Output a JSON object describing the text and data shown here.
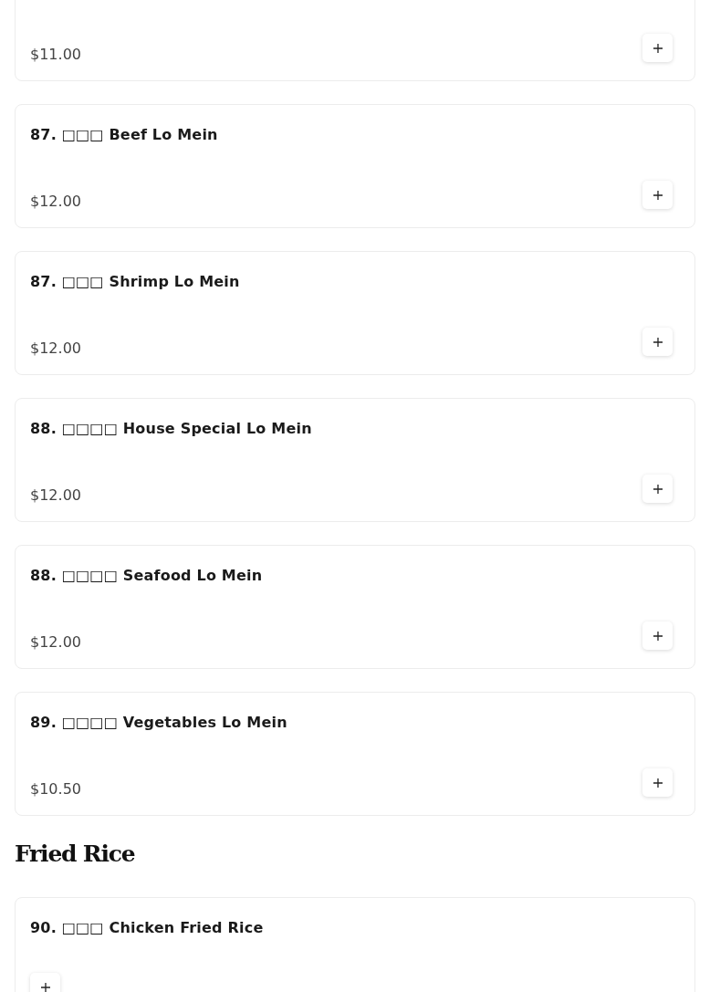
{
  "sections": [
    {
      "items": [
        {
          "price": "$11.00"
        },
        {
          "title": "87. □□□ Beef Lo Mein",
          "price": "$12.00"
        },
        {
          "title": "87. □□□ Shrimp Lo Mein",
          "price": "$12.00"
        },
        {
          "title": "88. □□□□ House Special Lo Mein",
          "price": "$12.00"
        },
        {
          "title": "88. □□□□ Seafood Lo Mein",
          "price": "$12.00"
        },
        {
          "title": "89. □□□□ Vegetables Lo Mein",
          "price": "$10.50"
        }
      ]
    },
    {
      "heading": "Fried Rice",
      "items": [
        {
          "title": "90. □□□ Chicken Fried Rice"
        }
      ]
    }
  ]
}
